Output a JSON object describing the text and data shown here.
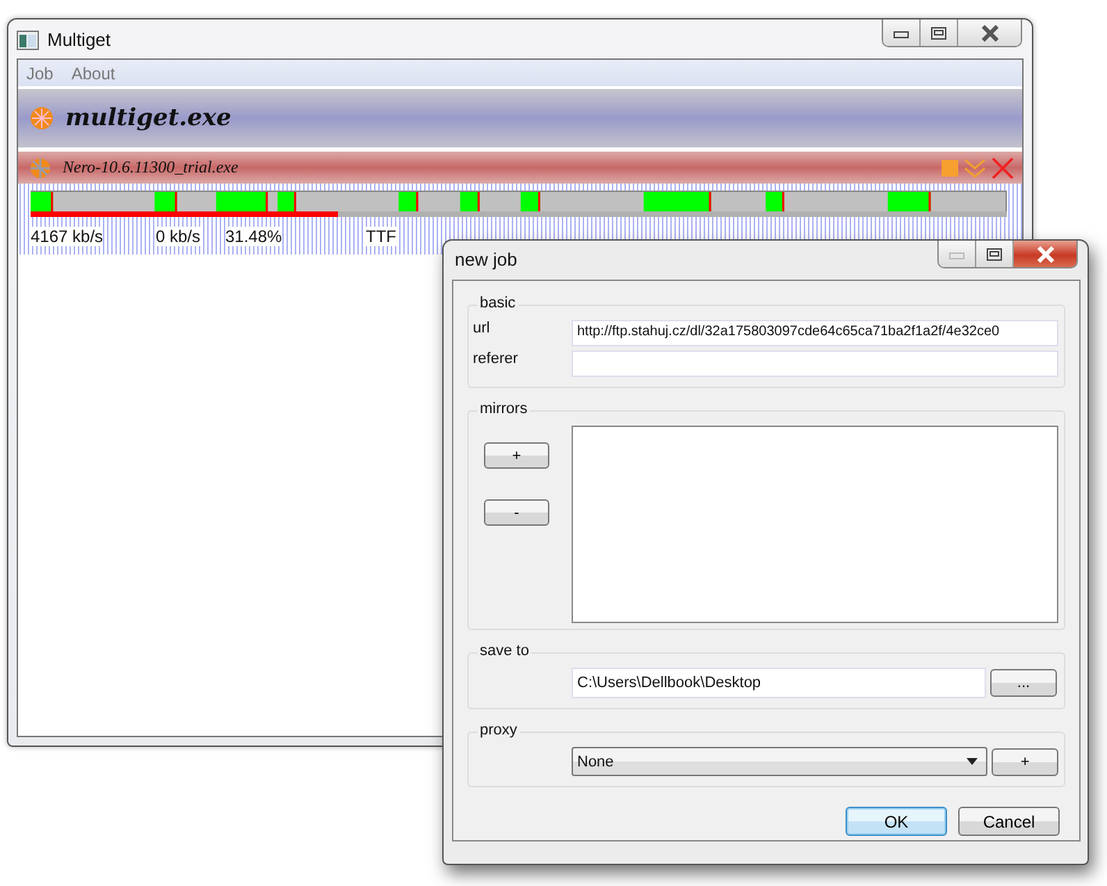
{
  "main_window": {
    "title": "Multiget",
    "menu": [
      {
        "label": "Job"
      },
      {
        "label": "About"
      }
    ],
    "header_title": "multiget.exe",
    "jobs": [
      {
        "name": "Nero-10.6.11300_trial.exe",
        "level": 0.3148,
        "speed": "4167 kb/s",
        "upload_speed": "0 kb/s",
        "percent": "31.48%",
        "column_4": "TTF"
      }
    ]
  },
  "dialog": {
    "title": "new job",
    "basic": {
      "title": "basic",
      "url_label": "url",
      "url": "http://ftp.stahuj.cz/dl/32a175803097cde64c65ca71ba2f1a2f/4e32ce0",
      "referer_label": "referer"
    },
    "mirrors": {
      "title": "mirrors",
      "add": "+",
      "remove": "-"
    },
    "save_to": {
      "title": "save to",
      "path": "C:\\Users\\Dellbook\\Desktop",
      "browse": "..."
    },
    "proxy": {
      "title": "proxy",
      "selected": "None",
      "add": "+"
    },
    "buttons": [
      {
        "label": "OK",
        "default": true
      },
      {
        "label": "Cancel",
        "default": false
      }
    ]
  }
}
